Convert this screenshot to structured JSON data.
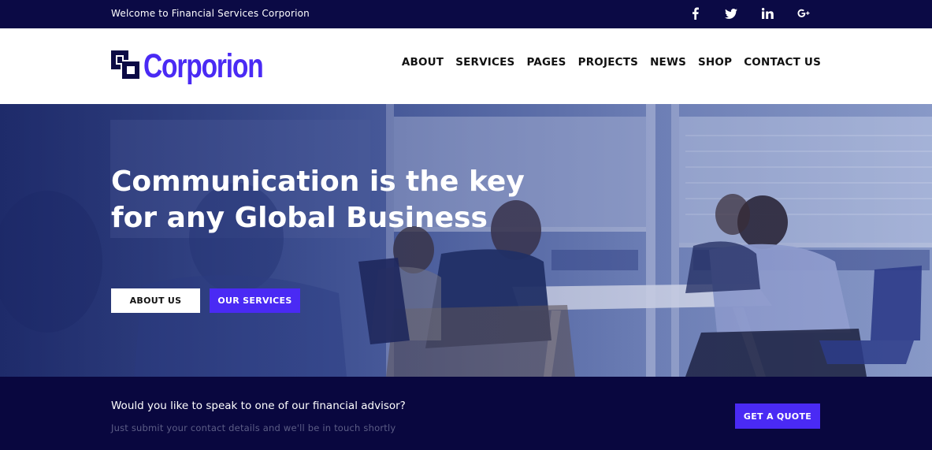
{
  "topbar": {
    "welcome": "Welcome to Financial Services Corporion",
    "social": [
      "facebook-icon",
      "twitter-icon",
      "linkedin-icon",
      "google-plus-icon"
    ]
  },
  "header": {
    "logo_text": "Corporion",
    "nav": [
      "ABOUT",
      "SERVICES",
      "PAGES",
      "PROJECTS",
      "NEWS",
      "SHOP",
      "CONTACT US"
    ]
  },
  "hero": {
    "title_line1": "Communication is the key",
    "title_line2": "for any Global Business",
    "about_label": "ABOUT US",
    "services_label": "OUR SERVICES"
  },
  "cta": {
    "question": "Would you like to speak to one of our financial advisor?",
    "subtext": "Just submit your contact details and we'll be in touch shortly",
    "button_label": "GET A QUOTE"
  },
  "colors": {
    "brand": "#4a2af4",
    "topbar": "#0b0a45",
    "cta_band": "#09073f"
  }
}
